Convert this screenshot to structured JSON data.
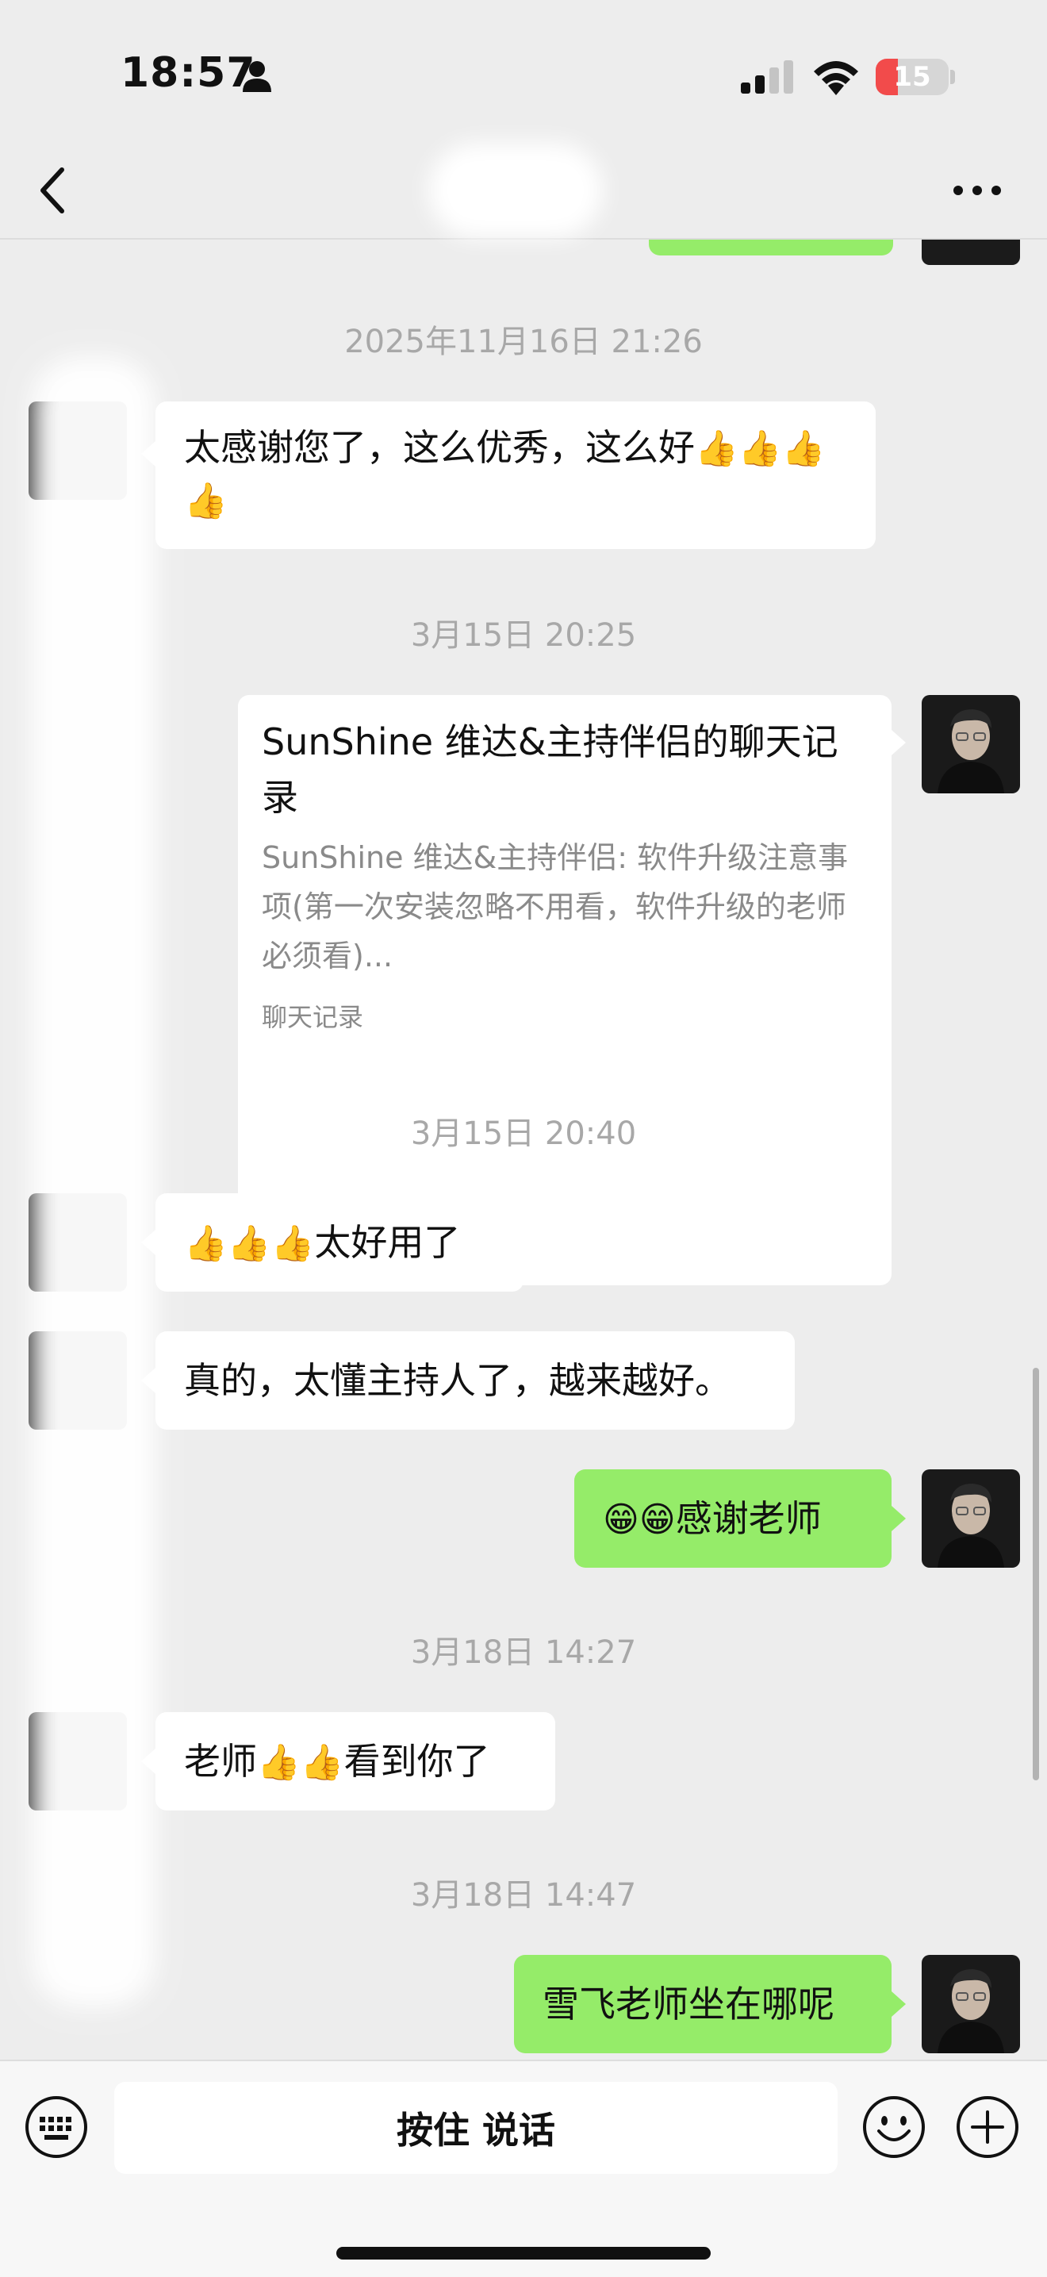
{
  "status_bar": {
    "time": "18:57",
    "battery": "15",
    "battery_level": 0.15
  },
  "nav": {
    "back": "back",
    "more": "more"
  },
  "messages": {
    "t1": "2025年11月16日 21:26",
    "m1": "太感谢您了，这么优秀，这么好",
    "m1_emoji": "👍👍👍👍",
    "t2": "3月15日 20:25",
    "card_title": "SunShine 维达&主持伴侣的聊天记录",
    "card_preview": "SunShine 维达&主持伴侣: 软件升级注意事项(第一次安装忽略不用看，软件升级的老师必须看)...",
    "card_tag": "聊天记录",
    "t3": "3月15日 20:40",
    "m2_emoji": "👍👍👍",
    "m2": "太好用了",
    "m3": "真的，太懂主持人了，越来越好。",
    "m4_emoji": "😁😁",
    "m4": "感谢老师",
    "t4": "3月18日 14:27",
    "m5_pre": "老师",
    "m5_emoji": "👍👍",
    "m5_post": "看到你了",
    "t5": "3月18日 14:47",
    "m6": "雪飞老师坐在哪呢"
  },
  "input_bar": {
    "voice_label": "按住 说话"
  },
  "colors": {
    "bg": "#ededed",
    "green_bubble": "#95ec69",
    "white_bubble": "#ffffff",
    "battery_low": "#f24b4b"
  }
}
